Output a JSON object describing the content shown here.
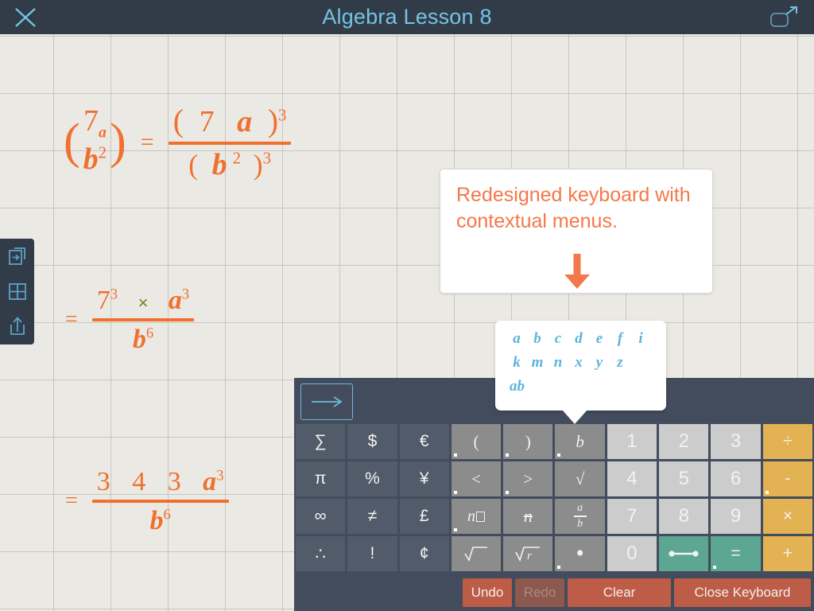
{
  "titlebar": {
    "title": "Algebra Lesson 8",
    "close_icon": "close-x-icon",
    "expand_icon": "expand-fullscreen-icon"
  },
  "rail": {
    "items": [
      {
        "name": "next-page-icon",
        "label": "Next Page"
      },
      {
        "name": "grid-icon",
        "label": "Grid"
      },
      {
        "name": "share-icon",
        "label": "Share"
      }
    ]
  },
  "canvas": {
    "expressions": [
      {
        "id": "expr-1",
        "latex": "(7a / b^2) = (7a)^3 / (b^2)^3",
        "lhs": {
          "open": "(",
          "numerator": "7",
          "numerator_sub": "a",
          "denominator": "b",
          "denominator_sup": "2",
          "close": ")"
        },
        "equals": "=",
        "rhs_num": {
          "open": "(",
          "terms": [
            "7",
            "a"
          ],
          "close": ")",
          "exp": "3"
        },
        "rhs_den": {
          "open": "(",
          "base": "b",
          "base_sup": "2",
          "close": ")",
          "exp": "3"
        }
      },
      {
        "id": "expr-2",
        "latex": "= 7^3 \\times a^3 / b^6",
        "equals": "=",
        "numerator": [
          {
            "base": "7",
            "sup": "3"
          },
          {
            "op": "×"
          },
          {
            "base": "a",
            "sup": "3",
            "italic": true
          }
        ],
        "denominator": {
          "base": "b",
          "sup": "6",
          "italic": true
        }
      },
      {
        "id": "expr-3",
        "latex": "= 343 a^3 / b^6",
        "equals": "=",
        "numerator_digits": [
          "3",
          "4",
          "3"
        ],
        "numerator_var": {
          "base": "a",
          "sup": "3"
        },
        "denominator": {
          "base": "b",
          "sup": "6"
        }
      }
    ]
  },
  "callout": {
    "text": "Redesigned keyboard with contextual menus.",
    "arrow_icon": "down-arrow-icon",
    "color": "#f4784a"
  },
  "variable_popup": {
    "rows": [
      [
        "a",
        "b",
        "c",
        "d",
        "e",
        "f",
        "i"
      ],
      [
        "k",
        "m",
        "n",
        "x",
        "y",
        "z"
      ],
      [
        "ab"
      ]
    ],
    "color": "#5cb4dd"
  },
  "keyboard": {
    "enter_key": "→",
    "rows": [
      [
        {
          "label": "∑",
          "style": "dark",
          "name": "key-sigma"
        },
        {
          "label": "$",
          "style": "dark",
          "name": "key-dollar"
        },
        {
          "label": "€",
          "style": "dark",
          "name": "key-euro"
        },
        {
          "label": "(",
          "style": "mid",
          "name": "key-open-paren",
          "menu": true
        },
        {
          "label": ")",
          "style": "mid",
          "name": "key-close-paren",
          "menu": true
        },
        {
          "label": "b",
          "style": "mid",
          "name": "key-variable-b",
          "menu": true,
          "italic": true
        },
        {
          "label": "1",
          "style": "lite",
          "name": "key-1"
        },
        {
          "label": "2",
          "style": "lite",
          "name": "key-2"
        },
        {
          "label": "3",
          "style": "lite",
          "name": "key-3"
        },
        {
          "label": "÷",
          "style": "amber",
          "name": "key-divide"
        }
      ],
      [
        {
          "label": "π",
          "style": "dark",
          "name": "key-pi"
        },
        {
          "label": "%",
          "style": "dark",
          "name": "key-percent"
        },
        {
          "label": "¥",
          "style": "dark",
          "name": "key-yen"
        },
        {
          "label": "<",
          "style": "mid",
          "name": "key-less-than",
          "menu": true
        },
        {
          "label": ">",
          "style": "mid",
          "name": "key-greater-than",
          "menu": true
        },
        {
          "label": "√",
          "style": "mid",
          "name": "key-sqrt"
        },
        {
          "label": "4",
          "style": "lite",
          "name": "key-4"
        },
        {
          "label": "5",
          "style": "lite",
          "name": "key-5"
        },
        {
          "label": "6",
          "style": "lite",
          "name": "key-6"
        },
        {
          "label": "-",
          "style": "amber",
          "name": "key-minus",
          "menu": true
        }
      ],
      [
        {
          "label": "∞",
          "style": "dark",
          "name": "key-infinity"
        },
        {
          "label": "≠",
          "style": "dark",
          "name": "key-not-equal"
        },
        {
          "label": "£",
          "style": "dark",
          "name": "key-pound"
        },
        {
          "label": "n",
          "style": "mid",
          "name": "key-power",
          "menu": true,
          "glyph": "power"
        },
        {
          "label": "n",
          "style": "mid",
          "name": "key-script-n",
          "glyph": "script-n"
        },
        {
          "label": "a/b",
          "style": "mid",
          "name": "key-fraction",
          "glyph": "fraction"
        },
        {
          "label": "7",
          "style": "lite",
          "name": "key-7"
        },
        {
          "label": "8",
          "style": "lite",
          "name": "key-8"
        },
        {
          "label": "9",
          "style": "lite",
          "name": "key-9"
        },
        {
          "label": "×",
          "style": "amber",
          "name": "key-multiply"
        }
      ],
      [
        {
          "label": "∴",
          "style": "dark",
          "name": "key-therefore"
        },
        {
          "label": "!",
          "style": "dark",
          "name": "key-factorial"
        },
        {
          "label": "¢",
          "style": "dark",
          "name": "key-cent"
        },
        {
          "label": "√",
          "style": "mid",
          "name": "key-radical-empty",
          "glyph": "radical-empty"
        },
        {
          "label": "√r",
          "style": "mid",
          "name": "key-radical-r",
          "glyph": "radical-r"
        },
        {
          "label": "·",
          "style": "mid",
          "name": "key-dot",
          "menu": true,
          "glyph": "dot"
        },
        {
          "label": "0",
          "style": "lite",
          "name": "key-0"
        },
        {
          "label": "segment",
          "style": "teal",
          "name": "key-line-segment",
          "glyph": "segment"
        },
        {
          "label": "=",
          "style": "teal",
          "name": "key-equals",
          "menu": true
        },
        {
          "label": "+",
          "style": "amber",
          "name": "key-plus"
        }
      ]
    ],
    "actions": [
      {
        "label": "Undo",
        "name": "undo-button",
        "disabled": false
      },
      {
        "label": "Redo",
        "name": "redo-button",
        "disabled": true
      },
      {
        "label": "Clear",
        "name": "clear-button",
        "disabled": false
      },
      {
        "label": "Close Keyboard",
        "name": "close-keyboard-button",
        "disabled": false
      }
    ]
  },
  "colors": {
    "titlebar": "#323b48",
    "title_text": "#74c4e3",
    "canvas": "#ebe9e4",
    "ink": "#f07030",
    "keyboard_bg": "#424c5c",
    "key_dark": "#525b69",
    "key_mid": "#8c8c8c",
    "key_light": "#cccccc",
    "key_amber": "#e3b253",
    "key_teal": "#5da692",
    "action_red": "#bd5c47",
    "accent_blue": "#5cb4dd"
  }
}
